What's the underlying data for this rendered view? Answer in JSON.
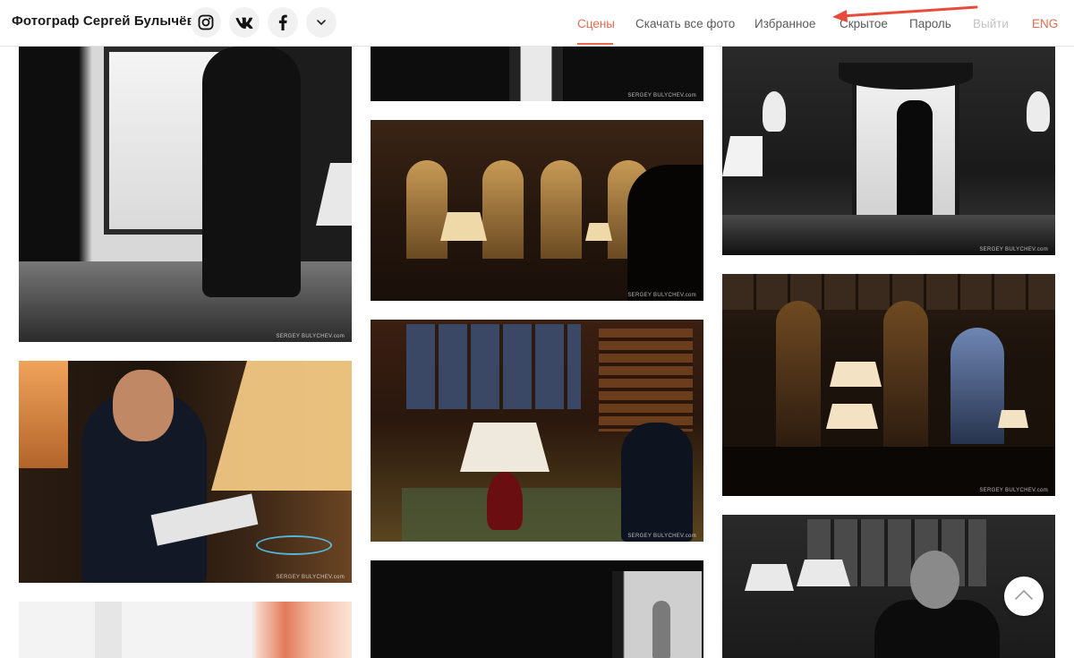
{
  "header": {
    "brand": "Фотограф Сергей Булычёв",
    "social": [
      {
        "icon": "instagram-icon"
      },
      {
        "icon": "vk-icon"
      },
      {
        "icon": "facebook-icon"
      },
      {
        "icon": "chevron-down-icon"
      }
    ],
    "nav": {
      "scenes": "Сцены",
      "download_all": "Скачать все фото",
      "favorites": "Избранное",
      "hidden": "Скрытое",
      "password": "Пароль",
      "logout": "Выйти",
      "lang": "ENG"
    },
    "active_item": "scenes",
    "colors": {
      "accent": "#ec6a4e",
      "highlight_box": "#e84a3c",
      "disabled": "#c3c3c3"
    }
  },
  "gallery": {
    "watermark": "SERGEY BULYCHEV.com",
    "photos": [
      {
        "subject": "man in suit walking toward window, black and white"
      },
      {
        "subject": "man in suit, white shirt, cropped"
      },
      {
        "subject": "wood-panelled room with arched windows and lamps"
      },
      {
        "subject": "man reading magazine in library with paintings"
      },
      {
        "subject": "dark doorway with woman in light dress"
      },
      {
        "subject": "man standing by window, black and white"
      },
      {
        "subject": "dark room with arches and blue-lit window"
      },
      {
        "subject": "portrait of man in library, black and white"
      },
      {
        "subject": "man in suit reading magazine near lamp"
      },
      {
        "subject": "bright room with coral curtains"
      }
    ]
  },
  "scroll_top": {
    "icon": "chevron-up-icon"
  }
}
